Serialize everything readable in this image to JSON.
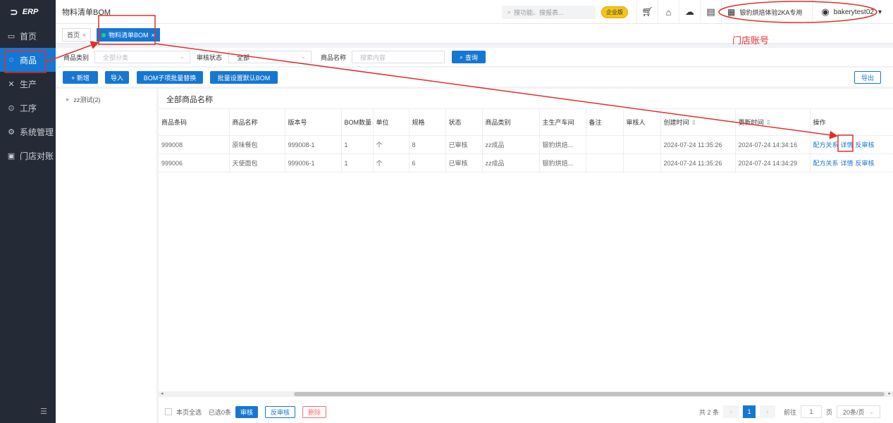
{
  "sidebar": {
    "logo_text": "ERP",
    "items": [
      {
        "label": "首页",
        "icon": "monitor-icon",
        "active": false
      },
      {
        "label": "商品",
        "icon": "circle-icon",
        "active": true
      },
      {
        "label": "生产",
        "icon": "tools-icon",
        "active": false
      },
      {
        "label": "工序",
        "icon": "gear-icon",
        "active": false
      },
      {
        "label": "系统管理",
        "icon": "settings-icon",
        "active": false
      },
      {
        "label": "门店对账",
        "icon": "ledger-icon",
        "active": false
      }
    ]
  },
  "topbar": {
    "title": "物料清单BOM",
    "search_placeholder": "搜功能、搜报表...",
    "edition_badge": "企业版",
    "store_name": "银豹烘焙体验2KA专用",
    "username": "bakerytest02"
  },
  "tabs": [
    {
      "label": "首页",
      "active": false
    },
    {
      "label": "物料清单BOM",
      "active": true
    }
  ],
  "filters": {
    "category_label": "商品类别",
    "category_value": "全部分类",
    "audit_label": "审核状态",
    "audit_value": "全部",
    "name_label": "商品名称",
    "name_placeholder": "搜索内容",
    "query_button": "查询"
  },
  "actions": {
    "add": "+ 新增",
    "import": "导入",
    "bom_replace": "BOM子项批量替换",
    "batch_default": "批量设置默认BOM",
    "export": "导出"
  },
  "tree": {
    "node": "zz测试(2)"
  },
  "main": {
    "title": "全部商品名称",
    "columns": [
      "商品条码",
      "商品名称",
      "版本号",
      "BOM数量",
      "单位",
      "规格",
      "状态",
      "商品类别",
      "主生产车间",
      "备注",
      "审核人",
      "创建时间",
      "更新时间",
      "操作"
    ],
    "rows": [
      {
        "barcode": "999008",
        "name": "原味餐包",
        "version": "999008-1",
        "bom_qty": "1",
        "unit": "个",
        "spec": "8",
        "status": "已审核",
        "category": "zz成品",
        "workshop": "银豹烘焙...",
        "remark": "",
        "auditor": "",
        "created": "2024-07-24 11:35:26",
        "updated": "2024-07-24 14:34:16"
      },
      {
        "barcode": "999006",
        "name": "天使面包",
        "version": "999006-1",
        "bom_qty": "1",
        "unit": "个",
        "spec": "6",
        "status": "已审核",
        "category": "zz成品",
        "workshop": "银豹烘焙...",
        "remark": "",
        "auditor": "",
        "created": "2024-07-24 11:35:26",
        "updated": "2024-07-24 14:34:29"
      }
    ],
    "row_ops": [
      "配方关系",
      "详情",
      "反审核"
    ]
  },
  "footer": {
    "select_all": "本页全选",
    "selected": "已选0条",
    "audit": "审核",
    "unaudit": "反审核",
    "delete": "删除",
    "total": "共 2 条",
    "current_page": "1",
    "goto_label": "前往",
    "goto_page": "1",
    "page_suffix": "页",
    "page_size": "20条/页"
  },
  "annotation": {
    "store_account": "门店账号",
    "color": "#e0302c"
  }
}
